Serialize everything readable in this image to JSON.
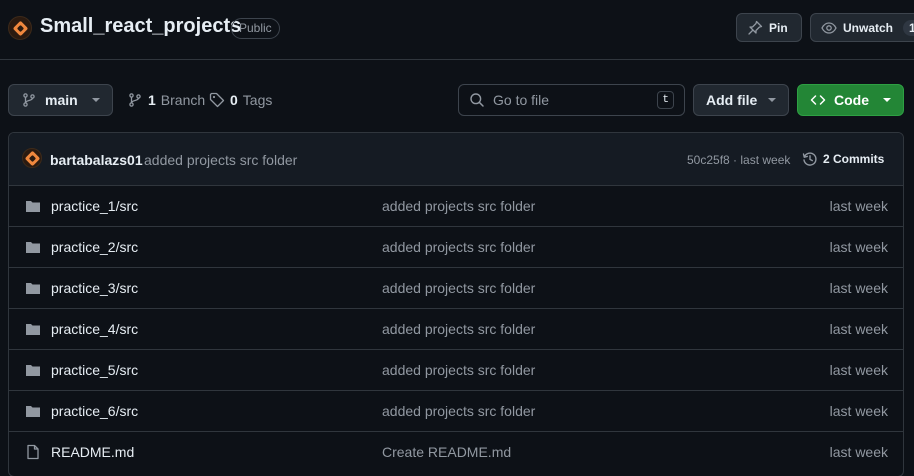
{
  "repo": {
    "name": "Small_react_projects",
    "visibility": "Public",
    "pin_label": "Pin",
    "unwatch_label": "Unwatch",
    "watch_count": "1"
  },
  "toolbar": {
    "branch": "main",
    "branch_count": "1",
    "branch_label": "Branch",
    "tag_count": "0",
    "tag_label": "Tags",
    "goto_placeholder": "Go to file",
    "goto_shortcut": "t",
    "addfile_label": "Add file",
    "code_label": "Code"
  },
  "commit": {
    "author": "bartabalazs01",
    "message": "added projects src folder",
    "hash_time": "50c25f8 · last week",
    "commits_label": "2 Commits"
  },
  "files": [
    {
      "name": "practice_1/src",
      "type": "folder",
      "message": "added projects src folder",
      "date": "last week"
    },
    {
      "name": "practice_2/src",
      "type": "folder",
      "message": "added projects src folder",
      "date": "last week"
    },
    {
      "name": "practice_3/src",
      "type": "folder",
      "message": "added projects src folder",
      "date": "last week"
    },
    {
      "name": "practice_4/src",
      "type": "folder",
      "message": "added projects src folder",
      "date": "last week"
    },
    {
      "name": "practice_5/src",
      "type": "folder",
      "message": "added projects src folder",
      "date": "last week"
    },
    {
      "name": "practice_6/src",
      "type": "folder",
      "message": "added projects src folder",
      "date": "last week"
    },
    {
      "name": "README.md",
      "type": "file",
      "message": "Create README.md",
      "date": "last week"
    }
  ],
  "colors": {
    "background": "#0d1117",
    "accent_green": "#238636",
    "avatar_orange": "#f0883e",
    "muted_text": "#9198a1"
  }
}
